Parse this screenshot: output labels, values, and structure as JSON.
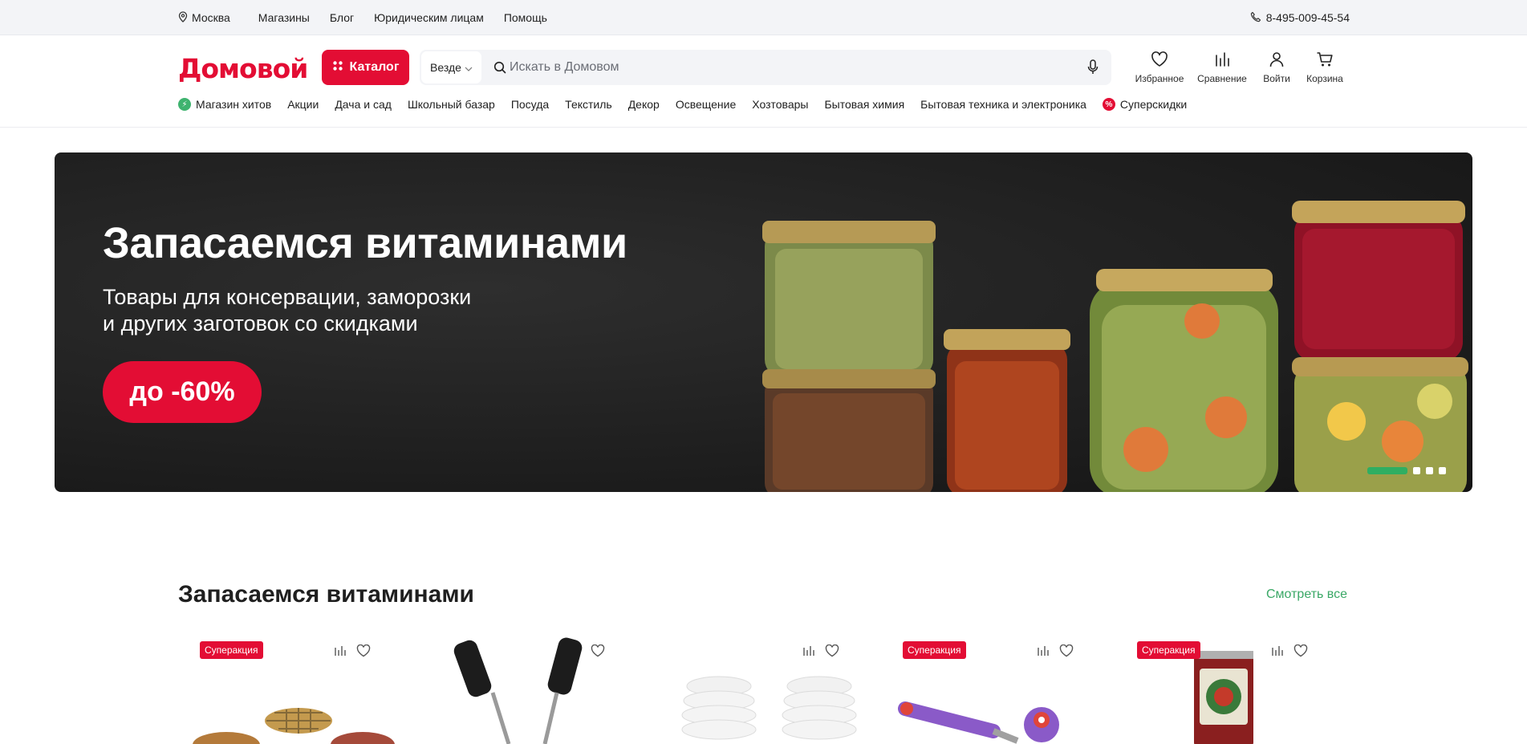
{
  "topbar": {
    "city": "Москва",
    "links": [
      "Магазины",
      "Блог",
      "Юридическим лицам",
      "Помощь"
    ],
    "phone": "8-495-009-45-54"
  },
  "header": {
    "logo": "Домовой",
    "catalog": "Каталог",
    "search_scope": "Везде",
    "search_placeholder": "Искать в Домовом",
    "icons": {
      "favorites": "Избранное",
      "compare": "Сравнение",
      "login": "Войти",
      "cart": "Корзина"
    },
    "nav": [
      "Магазин хитов",
      "Акции",
      "Дача и сад",
      "Школьный базар",
      "Посуда",
      "Текстиль",
      "Декор",
      "Освещение",
      "Хозтовары",
      "Бытовая химия",
      "Бытовая техника и электроника",
      "Суперскидки"
    ]
  },
  "banner": {
    "title": "Запасаемся витаминами",
    "subtitle_line1": "Товары для консервации, заморозки",
    "subtitle_line2": "и других заготовок со скидками",
    "promo": "до -60%"
  },
  "section": {
    "title": "Запасаемся витаминами",
    "see_all": "Смотреть все",
    "badge": "Суперакция"
  },
  "colors": {
    "brand": "#e30d34",
    "accent_green": "#3aa866"
  }
}
